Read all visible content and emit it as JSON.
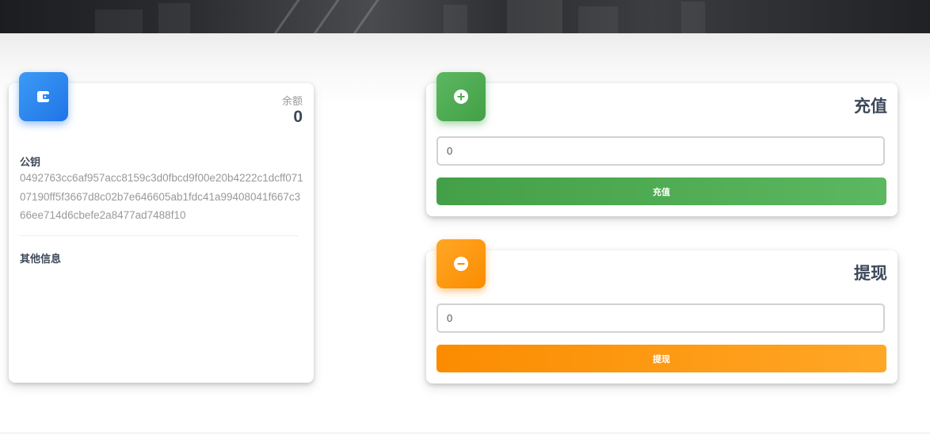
{
  "wallet": {
    "balance_label": "余额",
    "balance_value": "0",
    "pubkey_title": "公钥",
    "pubkey": "0492763cc6af957acc8159c3d0fbcd9f00e20b4222c1dcff07107190ff5f3667d8c02b7e646605ab1fdc41a99408041f667c366ee714d6cbefe2a8477ad7488f10",
    "other_info_title": "其他信息",
    "icon": "wallet-icon"
  },
  "deposit": {
    "title": "充值",
    "input_value": "0",
    "button_label": "充值",
    "icon": "add-circle-icon"
  },
  "withdraw": {
    "title": "提现",
    "input_value": "0",
    "button_label": "提现",
    "icon": "remove-circle-icon"
  },
  "colors": {
    "blue": "#1f74e8",
    "green": "#4caf50",
    "orange": "#fb8c00",
    "heading": "#3c4858",
    "muted": "#999999"
  }
}
